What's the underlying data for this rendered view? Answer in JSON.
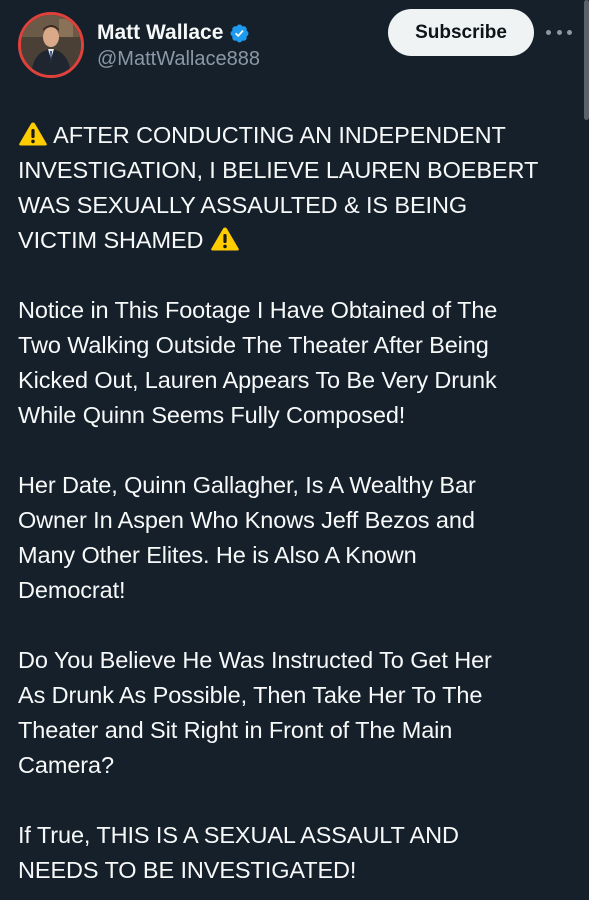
{
  "author": {
    "display_name": "Matt Wallace",
    "handle": "@MattWallace888",
    "verified": true,
    "avatar_border_color": "#e0413b"
  },
  "actions": {
    "subscribe_label": "Subscribe",
    "more_icon": "more-horizontal-icon"
  },
  "colors": {
    "background": "#15202b",
    "text": "#f7f9f9",
    "secondary_text": "#8b98a5",
    "verified_badge": "#1d9bf0",
    "warning_emoji": "#ffcc00"
  },
  "tweet": {
    "paragraphs": [
      {
        "lines": [
          {
            "warn_before": true,
            "text": "AFTER CONDUCTING AN INDEPENDENT"
          },
          {
            "text": "INVESTIGATION, I BELIEVE LAUREN BOEBERT"
          },
          {
            "text": "WAS SEXUALLY ASSAULTED & IS BEING"
          },
          {
            "text": "VICTIM SHAMED",
            "warn_after": true
          }
        ]
      },
      {
        "lines": [
          {
            "text": "Notice in This Footage I Have Obtained of The"
          },
          {
            "text": "Two Walking Outside The Theater After Being"
          },
          {
            "text": "Kicked Out, Lauren Appears To Be Very Drunk"
          },
          {
            "text": "While Quinn Seems Fully Composed!"
          }
        ]
      },
      {
        "lines": [
          {
            "text": "Her Date, Quinn Gallagher, Is A Wealthy Bar"
          },
          {
            "text": "Owner In Aspen Who Knows Jeff Bezos and"
          },
          {
            "text": "Many Other Elites. He is Also A Known"
          },
          {
            "text": "Democrat!"
          }
        ]
      },
      {
        "lines": [
          {
            "text": "Do You Believe He Was Instructed To Get Her"
          },
          {
            "text": "As Drunk As Possible, Then Take Her To The"
          },
          {
            "text": "Theater and Sit Right in Front of The Main"
          },
          {
            "text": "Camera?"
          }
        ]
      },
      {
        "lines": [
          {
            "text": "If True, THIS IS A SEXUAL ASSAULT AND"
          },
          {
            "text": "NEEDS TO BE INVESTIGATED!"
          }
        ]
      }
    ]
  }
}
